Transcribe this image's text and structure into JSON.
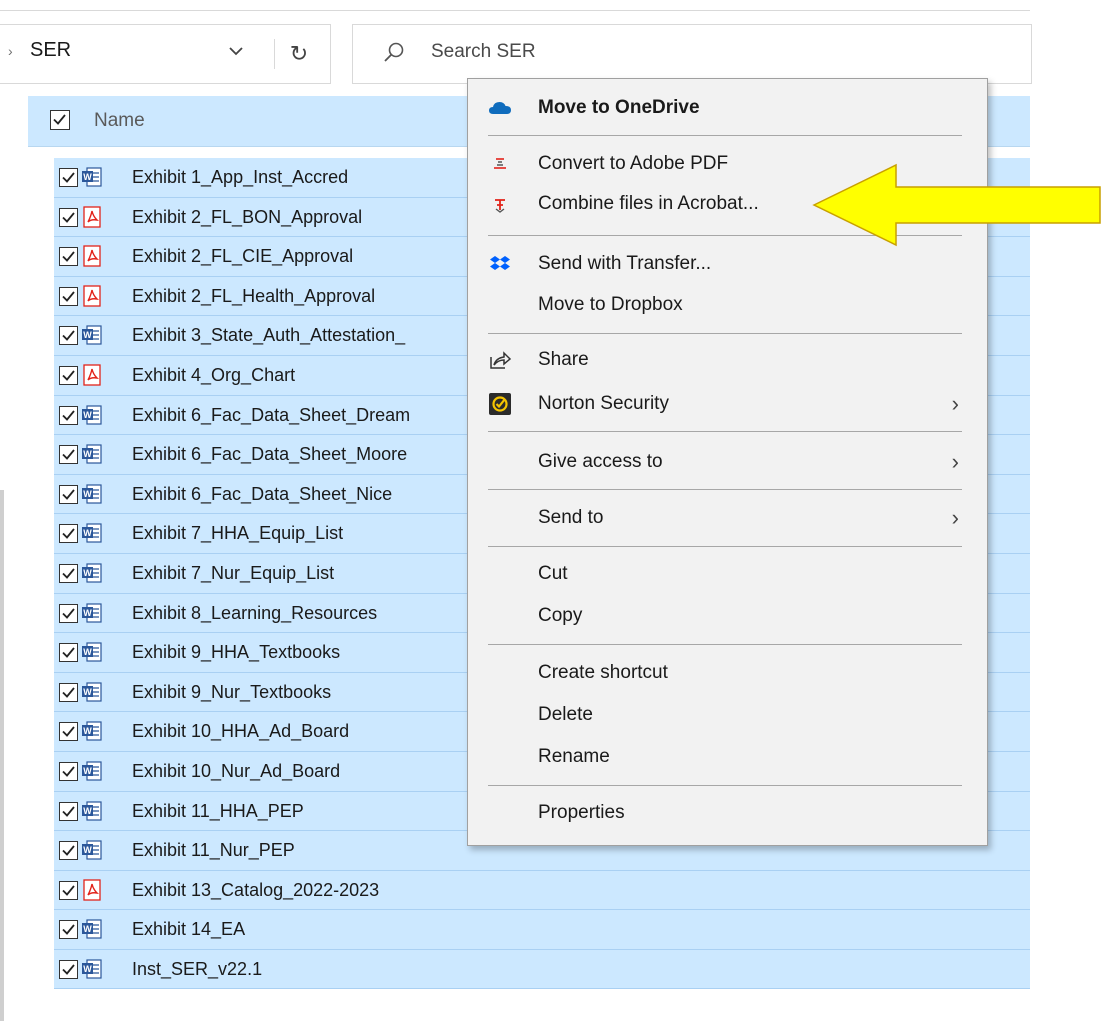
{
  "address": {
    "crumb_chevron": "›",
    "path": "SER",
    "dropdown": "⌄",
    "refresh": "↻"
  },
  "search": {
    "placeholder": "Search SER"
  },
  "header": {
    "name_column": "Name"
  },
  "files": [
    {
      "name": "Exhibit 1_App_Inst_Accred",
      "type": "word"
    },
    {
      "name": "Exhibit 2_FL_BON_Approval",
      "type": "pdf"
    },
    {
      "name": "Exhibit 2_FL_CIE_Approval",
      "type": "pdf"
    },
    {
      "name": "Exhibit 2_FL_Health_Approval",
      "type": "pdf"
    },
    {
      "name": "Exhibit 3_State_Auth_Attestation_",
      "type": "word"
    },
    {
      "name": "Exhibit 4_Org_Chart",
      "type": "pdf"
    },
    {
      "name": "Exhibit 6_Fac_Data_Sheet_Dream",
      "type": "word"
    },
    {
      "name": "Exhibit 6_Fac_Data_Sheet_Moore",
      "type": "word"
    },
    {
      "name": "Exhibit 6_Fac_Data_Sheet_Nice",
      "type": "word"
    },
    {
      "name": "Exhibit 7_HHA_Equip_List",
      "type": "word"
    },
    {
      "name": "Exhibit 7_Nur_Equip_List",
      "type": "word"
    },
    {
      "name": "Exhibit 8_Learning_Resources",
      "type": "word"
    },
    {
      "name": "Exhibit 9_HHA_Textbooks",
      "type": "word"
    },
    {
      "name": "Exhibit 9_Nur_Textbooks",
      "type": "word"
    },
    {
      "name": "Exhibit 10_HHA_Ad_Board",
      "type": "word"
    },
    {
      "name": "Exhibit 10_Nur_Ad_Board",
      "type": "word"
    },
    {
      "name": "Exhibit 11_HHA_PEP",
      "type": "word"
    },
    {
      "name": "Exhibit 11_Nur_PEP",
      "type": "word"
    },
    {
      "name": "Exhibit 13_Catalog_2022-2023",
      "type": "pdf"
    },
    {
      "name": "Exhibit 14_EA",
      "type": "word"
    },
    {
      "name": "Inst_SER_v22.1",
      "type": "word"
    }
  ],
  "context_menu": {
    "move_onedrive": "Move to OneDrive",
    "convert_pdf": "Convert to Adobe PDF",
    "combine_acrobat": "Combine files in Acrobat...",
    "send_transfer": "Send with Transfer...",
    "move_dropbox": "Move to Dropbox",
    "share": "Share",
    "norton": "Norton Security",
    "give_access": "Give access to",
    "send_to": "Send to",
    "cut": "Cut",
    "copy": "Copy",
    "create_shortcut": "Create shortcut",
    "delete": "Delete",
    "rename": "Rename",
    "properties": "Properties",
    "submenu_arrow": "›"
  },
  "colors": {
    "selection": "#cce8ff",
    "menu_bg": "#f2f2f2",
    "arrow_fill": "#ffff00",
    "arrow_stroke": "#c8a000",
    "onedrive": "#0f6cbd",
    "dropbox": "#0061fe",
    "pdf_red": "#e2231a",
    "word_blue": "#2b579a"
  },
  "icons": {
    "onedrive": "onedrive-cloud-icon",
    "convert_pdf": "adobe-pdf-icon",
    "combine": "acrobat-combine-icon",
    "transfer": "dropbox-icon",
    "share": "share-icon",
    "norton": "norton-check-icon"
  }
}
